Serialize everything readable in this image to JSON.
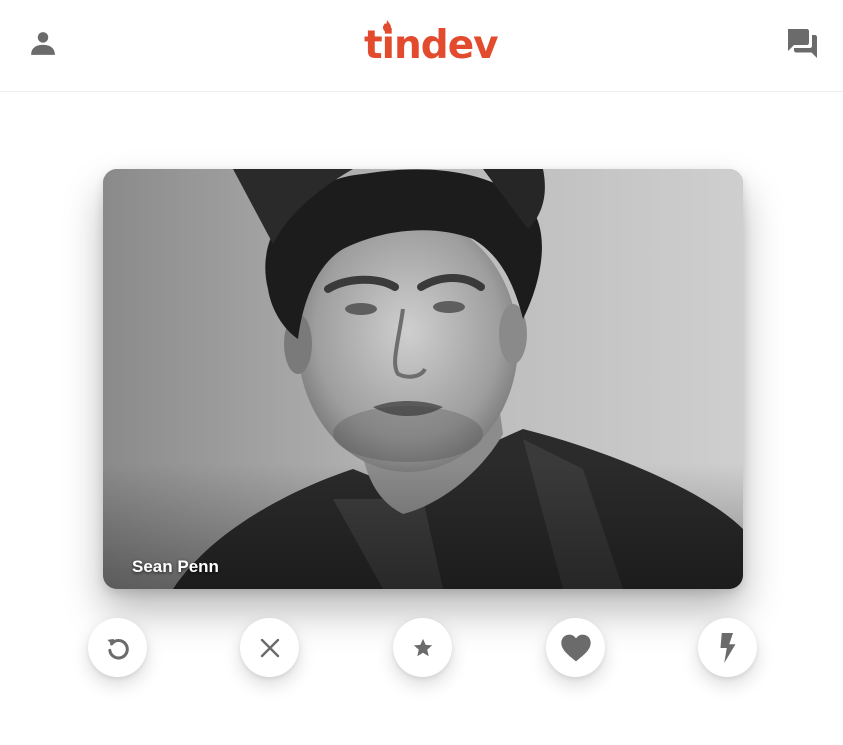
{
  "header": {
    "logo_text": "tindev",
    "profile_icon": "person-icon",
    "chat_icon": "chat-bubbles-icon"
  },
  "card": {
    "name": "Sean Penn",
    "photo": "black-and-white portrait"
  },
  "actions": [
    {
      "icon": "undo-icon"
    },
    {
      "icon": "close-icon"
    },
    {
      "icon": "star-icon"
    },
    {
      "icon": "heart-icon"
    },
    {
      "icon": "bolt-icon"
    }
  ],
  "colors": {
    "brand": "#e24b2e",
    "icon_gray": "#6b6b6b",
    "background": "#ffffff"
  }
}
